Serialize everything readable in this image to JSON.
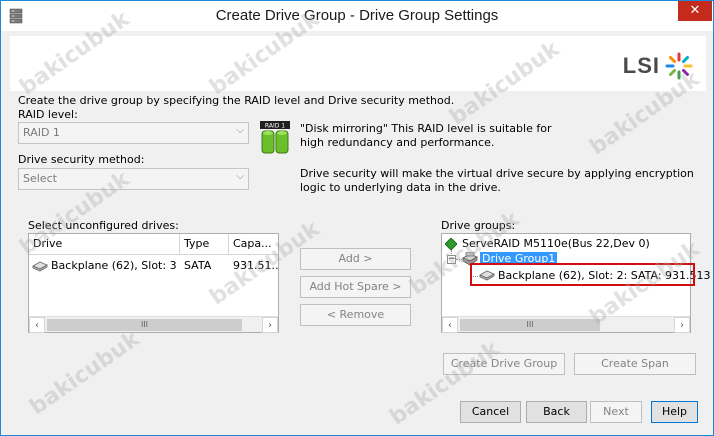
{
  "window": {
    "title": "Create Drive Group - Drive Group Settings",
    "close_symbol": "✕"
  },
  "logo": {
    "text": "LSI"
  },
  "intro_text": "Create the drive group by specifying the RAID level and Drive security method.",
  "raid_level": {
    "label": "RAID level:",
    "value": "RAID 1",
    "icon_text": "RAID 1",
    "description": "\"Disk mirroring\" This RAID level is suitable for high redundancy and performance."
  },
  "drive_security": {
    "label": "Drive security method:",
    "value": "Select",
    "description": "Drive security will make the virtual drive secure by applying encryption logic to underlying data in the drive."
  },
  "unconfigured": {
    "label": "Select unconfigured drives:",
    "columns": [
      "Drive",
      "Type",
      "Capa..."
    ],
    "rows": [
      {
        "drive": "Backplane (62), Slot: 3",
        "type": "SATA",
        "capacity": "931.51..."
      }
    ]
  },
  "middle_buttons": {
    "add": "Add >",
    "add_hot_spare": "Add Hot Spare >",
    "remove": "< Remove"
  },
  "drive_groups": {
    "label": "Drive groups:",
    "controller": "ServeRAID M5110e(Bus 22,Dev 0)",
    "group": "Drive Group1",
    "drive": "Backplane (62), Slot: 2: SATA: 931.513",
    "expander": "−"
  },
  "group_buttons": {
    "create_drive_group": "Create Drive Group",
    "create_span": "Create Span"
  },
  "footer_buttons": {
    "cancel": "Cancel",
    "back": "Back",
    "next": "Next",
    "help": "Help"
  },
  "scrollbar_grip": "III",
  "watermark_text": "bakicubuk",
  "colors": {
    "accent": "#1c8ad8",
    "selection": "#3399ff",
    "highlight": "#d01010",
    "close": "#c42b1c"
  }
}
